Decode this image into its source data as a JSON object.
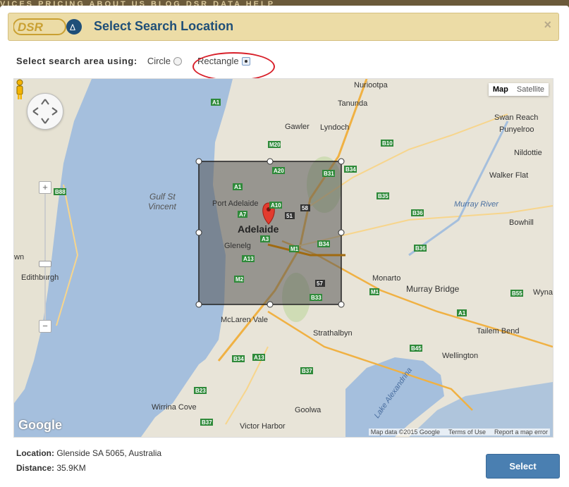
{
  "background_nav": "VICES   PRICING   ABOUT US   BLOG   DSR DATA   HELP",
  "modal": {
    "logo_text": "DSR",
    "title": "Select Search Location",
    "close_label": "×"
  },
  "search_area": {
    "label": "Select search area using:",
    "options": [
      {
        "label": "Circle",
        "checked": false
      },
      {
        "label": "Rectangle",
        "checked": true
      }
    ]
  },
  "map": {
    "type_buttons": [
      "Map",
      "Satellite"
    ],
    "active_type": "Map",
    "watermark": "Google",
    "attribution": [
      "Map data ©2015 Google",
      "Terms of Use",
      "Report a map error"
    ],
    "place_labels": {
      "nuriootpa": "Nuriootpa",
      "tanunda": "Tanunda",
      "gawler": "Gawler",
      "lyndoch": "Lyndoch",
      "swan_reach": "Swan Reach",
      "punyelroo": "Punyelroo",
      "nildottie": "Nildottie",
      "walker_flat": "Walker Flat",
      "gulf": "Gulf St",
      "vincent": "Vincent",
      "port_adelaide": "Port Adelaide",
      "adelaide": "Adelaide",
      "glenelg": "Glenelg",
      "murray_river": "Murray River",
      "bowhill": "Bowhill",
      "edithburgh": "Edithburgh",
      "monarto": "Monarto",
      "murray_bridge": "Murray Bridge",
      "wyna": "Wyna",
      "mclaren_vale": "McLaren Vale",
      "strathalbyn": "Strathalbyn",
      "tailem_bend": "Tailem Bend",
      "wellington": "Wellington",
      "lake_alexandrina": "Lake Alexandrina",
      "wirrina_cove": "Wirrina Cove",
      "goolwa": "Goolwa",
      "victor_harbor": "Victor Harbor",
      "wn": "wn"
    },
    "road_shields": {
      "a1_top": "A1",
      "m20": "M20",
      "a20": "A20",
      "b31": "B31",
      "b34_top": "B34",
      "b10": "B10",
      "b88": "B88",
      "a1_mid": "A1",
      "a7": "A7",
      "a10": "A10",
      "r58": "58",
      "r51": "51",
      "b35": "B35",
      "b36_a": "B36",
      "a3": "A3",
      "b34_mid": "B34",
      "m1_a": "M1",
      "a13_a": "A13",
      "b36_b": "B36",
      "m2": "M2",
      "r57": "57",
      "b33": "B33",
      "m1_b": "M1",
      "b55": "B55",
      "a1_right": "A1",
      "b34_low": "B34",
      "a13_low": "A13",
      "b45": "B45",
      "b37_a": "B37",
      "b23": "B23",
      "b37_b": "B37"
    }
  },
  "footer": {
    "location_label": "Location:",
    "location_value": "Glenside SA 5065, Australia",
    "distance_label": "Distance:",
    "distance_value": "35.9KM",
    "select_label": "Select"
  }
}
